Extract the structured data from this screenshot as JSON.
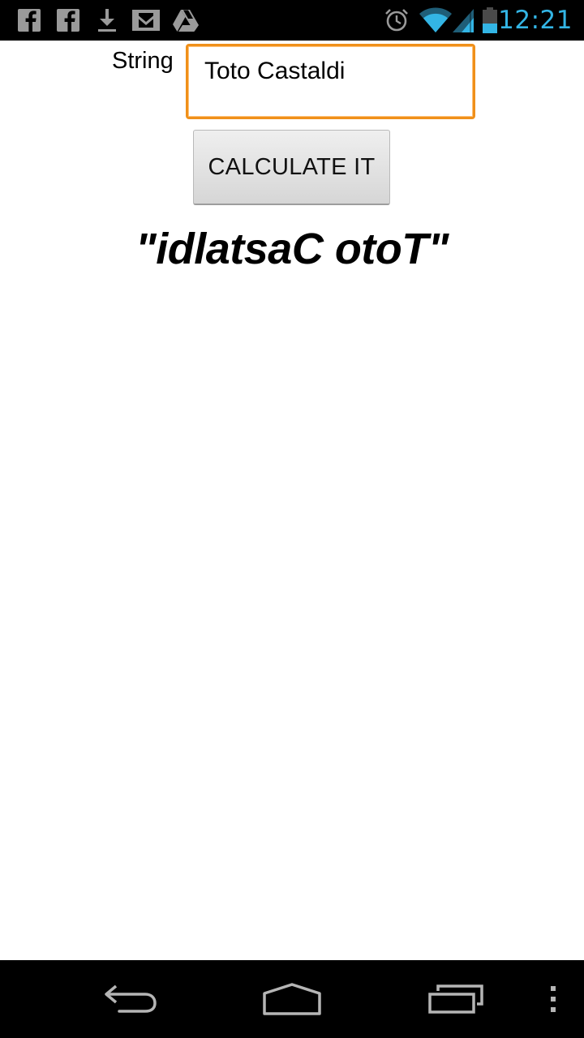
{
  "status_bar": {
    "left_icons": [
      "facebook-icon",
      "facebook-icon",
      "download-icon",
      "gmail-icon",
      "drive-icon"
    ],
    "right_icons": [
      "alarm-icon",
      "wifi-icon",
      "signal-icon",
      "battery-icon"
    ],
    "time": "12:21",
    "accent_color": "#33b5e5"
  },
  "form": {
    "string_label": "String",
    "string_value": "Toto Castaldi",
    "focus_color": "#f0901a",
    "calculate_label": "CALCULATE IT"
  },
  "result": {
    "text": "\"idlatsaC otoT\""
  },
  "nav_bar": {
    "buttons": [
      "back-icon",
      "home-icon",
      "recent-apps-icon",
      "menu-icon"
    ]
  }
}
